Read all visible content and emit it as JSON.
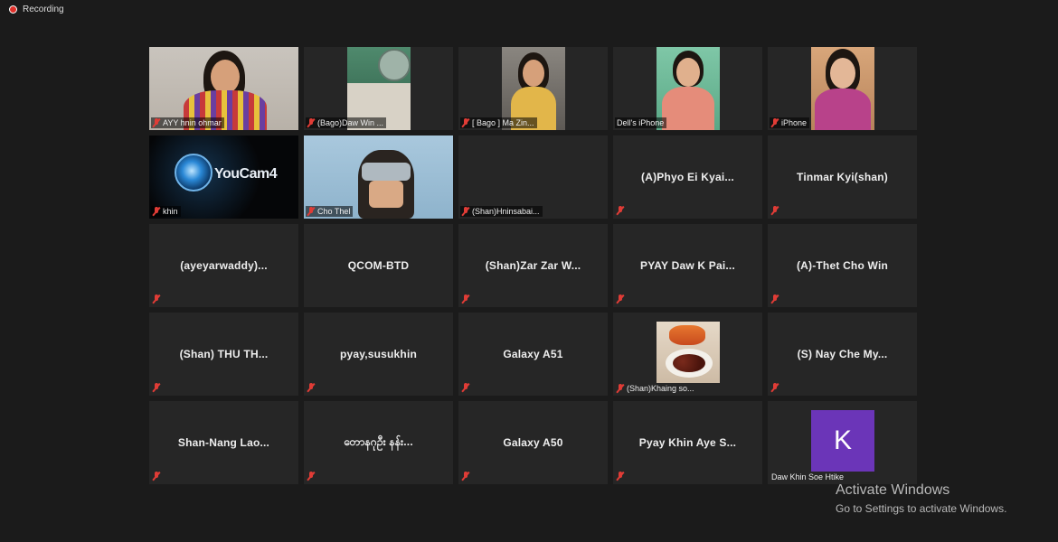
{
  "recording": {
    "label": "Recording"
  },
  "tiles": [
    {
      "name": "AYY hnin ohmar",
      "video": true
    },
    {
      "name": "(Bago)Daw Win ...",
      "video": true
    },
    {
      "name": "[ Bago ] Ma Zin...",
      "video": true
    },
    {
      "name": "Dell's iPhone",
      "video": true
    },
    {
      "name": "iPhone",
      "video": true
    },
    {
      "name": "khin",
      "video": true,
      "content": "YouCam4"
    },
    {
      "name": "Cho Thel",
      "video": true
    },
    {
      "name": "(Shan)Hninsabai...",
      "video": true
    },
    {
      "name": "(A)Phyo Ei Kyai...",
      "video": false
    },
    {
      "name": "Tinmar Kyi(shan)",
      "video": false
    },
    {
      "name": "(ayeyarwaddy)...",
      "video": false
    },
    {
      "name": "QCOM-BTD",
      "video": false
    },
    {
      "name": "(Shan)Zar Zar W...",
      "video": false
    },
    {
      "name": "PYAY Daw K Pai...",
      "video": false
    },
    {
      "name": "(A)-Thet Cho Win",
      "video": false
    },
    {
      "name": "(Shan) THU TH...",
      "video": false
    },
    {
      "name": "pyay,susukhin",
      "video": false
    },
    {
      "name": "Galaxy A51",
      "video": false
    },
    {
      "name": "(Shan)Khaing so...",
      "video": true
    },
    {
      "name": "(S) Nay Che My...",
      "video": false
    },
    {
      "name": "Shan-Nang Lao...",
      "video": false
    },
    {
      "name": "တောနဂုဦး နန်း...",
      "video": false
    },
    {
      "name": "Galaxy A50",
      "video": false
    },
    {
      "name": "Pyay Khin Aye S...",
      "video": false
    },
    {
      "name": "Daw Khin Soe Htike",
      "video": false,
      "avatar_letter": "K"
    }
  ],
  "watermark": {
    "title": "Activate Windows",
    "subtitle": "Go to Settings to activate Windows."
  },
  "colors": {
    "background": "#1b1b1b",
    "tile": "#262626",
    "muted_mic": "#e03c36",
    "avatar": "#6b35b8"
  }
}
